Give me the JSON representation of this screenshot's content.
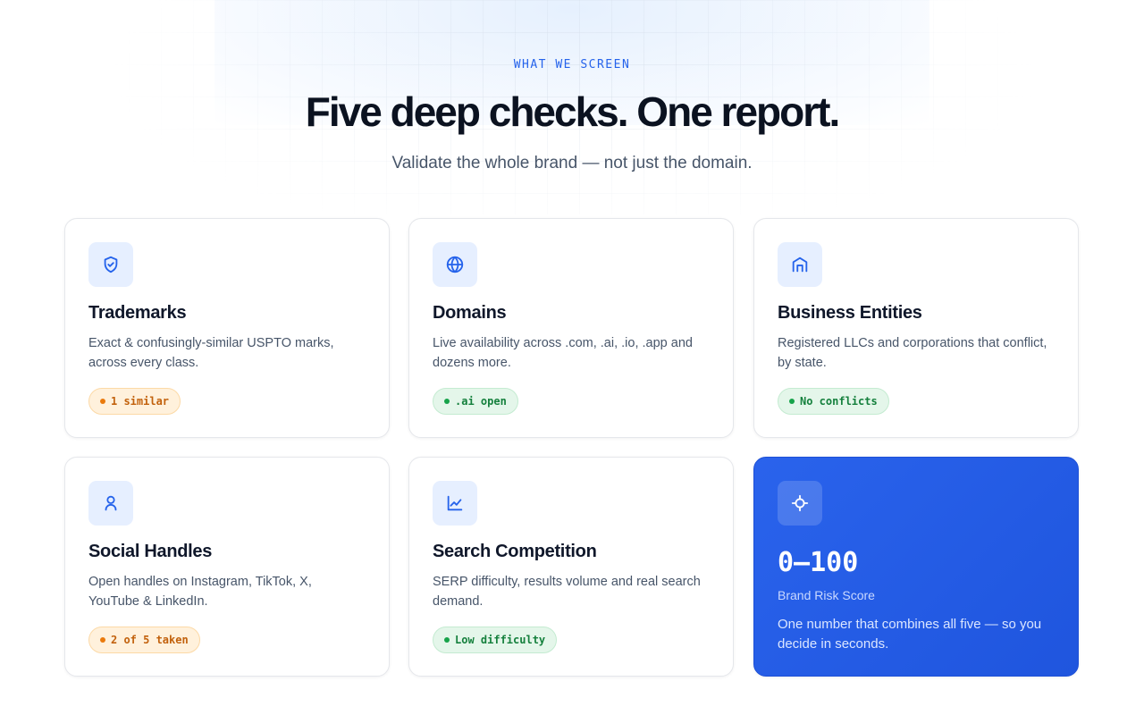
{
  "header": {
    "eyebrow": "WHAT WE SCREEN",
    "title": "Five deep checks. One report.",
    "subtitle": "Validate the whole brand — not just the domain."
  },
  "cards": [
    {
      "icon": "shield-check-icon",
      "title": "Trademarks",
      "description": "Exact & confusingly-similar USPTO marks, across every class.",
      "badge": "1 similar",
      "badge_status": "warning"
    },
    {
      "icon": "globe-icon",
      "title": "Domains",
      "description": "Live availability across .com, .ai, .io, .app and dozens more.",
      "badge": ".ai open",
      "badge_status": "success"
    },
    {
      "icon": "building-icon",
      "title": "Business Entities",
      "description": "Registered LLCs and corporations that conflict, by state.",
      "badge": "No conflicts",
      "badge_status": "success"
    },
    {
      "icon": "user-icon",
      "title": "Social Handles",
      "description": "Open handles on Instagram, TikTok, X, YouTube & LinkedIn.",
      "badge": "2 of 5 taken",
      "badge_status": "warning"
    },
    {
      "icon": "line-chart-icon",
      "title": "Search Competition",
      "description": "SERP difficulty, results volume and real search demand.",
      "badge": "Low difficulty",
      "badge_status": "success"
    }
  ],
  "score_card": {
    "icon": "crosshair-icon",
    "score": "0–100",
    "label": "Brand Risk Score",
    "description": "One number that combines all five — so you decide in seconds."
  },
  "colors": {
    "accent": "#2563eb",
    "warning": "#ea7a0c",
    "success": "#16a34a"
  }
}
